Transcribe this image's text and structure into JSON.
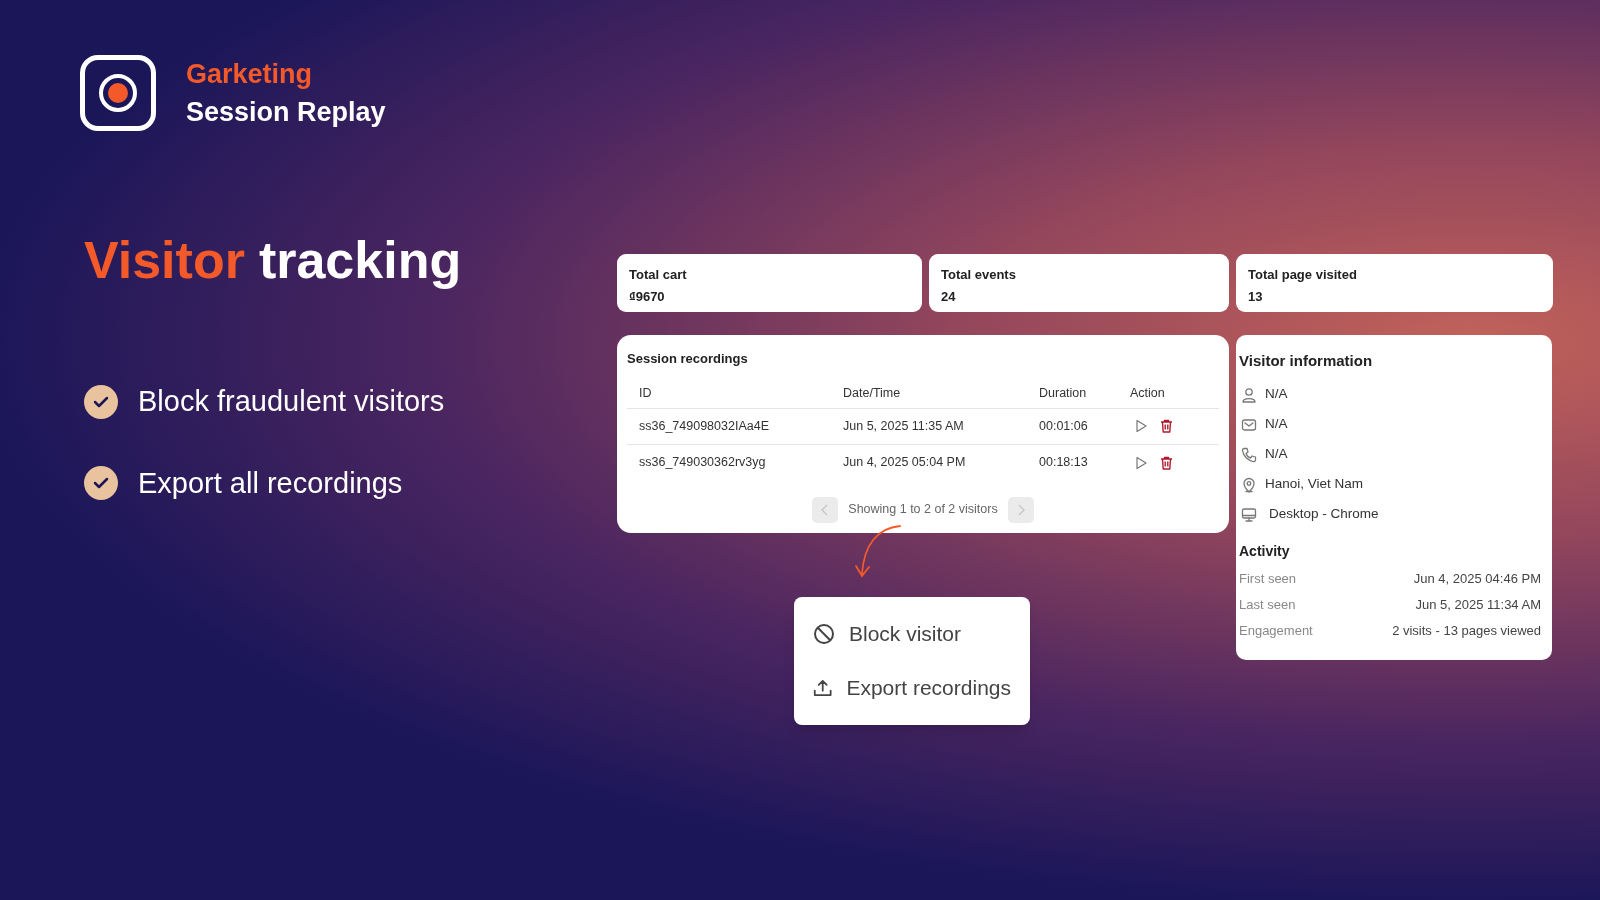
{
  "brand": {
    "name": "Garketing",
    "product": "Session Replay"
  },
  "headline": {
    "accent": "Visitor",
    "rest": "tracking"
  },
  "features": [
    {
      "label": "Block fraudulent visitors",
      "checked": true
    },
    {
      "label": "Export all recordings",
      "checked": true
    }
  ],
  "stats": [
    {
      "label": "Total cart",
      "value": "₫9670"
    },
    {
      "label": "Total events",
      "value": "24"
    },
    {
      "label": "Total page visited",
      "value": "13"
    }
  ],
  "session_recordings": {
    "title": "Session recordings",
    "columns": [
      "ID",
      "Date/Time",
      "Duration",
      "Action"
    ],
    "rows": [
      {
        "id": "ss36_749098032IAa4E",
        "datetime": "Jun 5, 2025 11:35 AM",
        "duration": "00:01:06"
      },
      {
        "id": "ss36_749030362rv3yg",
        "datetime": "Jun 4, 2025 05:04 PM",
        "duration": "00:18:13"
      }
    ],
    "pagination": {
      "text": "Showing 1 to 2 of 2 visitors",
      "prev_disabled": true,
      "next_disabled": true
    }
  },
  "visitor_information": {
    "title": "Visitor information",
    "fields": [
      {
        "kind": "person",
        "value": "N/A"
      },
      {
        "kind": "mail",
        "value": "N/A"
      },
      {
        "kind": "phone",
        "value": "N/A"
      },
      {
        "kind": "location",
        "value": "Hanoi, Viet Nam"
      },
      {
        "kind": "desktop",
        "value": "Desktop - Chrome"
      }
    ],
    "activity_title": "Activity",
    "activity": [
      {
        "label": "First seen",
        "value": "Jun 4, 2025 04:46 PM"
      },
      {
        "label": "Last seen",
        "value": "Jun 5, 2025 11:34 AM"
      },
      {
        "label": "Engagement",
        "value": "2 visits - 13 pages viewed"
      }
    ]
  },
  "menu": [
    {
      "kind": "block",
      "label": "Block visitor"
    },
    {
      "kind": "export",
      "label": "Export recordings"
    }
  ]
}
